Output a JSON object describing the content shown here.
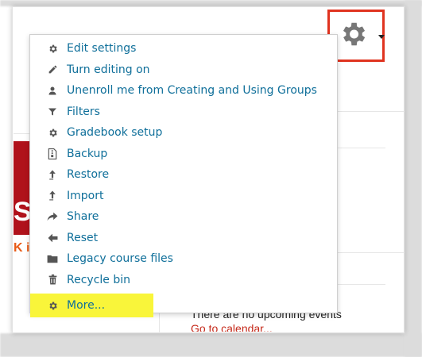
{
  "menu": {
    "items": [
      {
        "label": "Edit settings",
        "icon": "gear-icon"
      },
      {
        "label": "Turn editing on",
        "icon": "pencil-icon"
      },
      {
        "label": "Unenroll me from Creating and Using Groups",
        "icon": "user-icon"
      },
      {
        "label": "Filters",
        "icon": "filter-icon"
      },
      {
        "label": "Gradebook setup",
        "icon": "gear-icon"
      },
      {
        "label": "Backup",
        "icon": "file-archive-icon"
      },
      {
        "label": "Restore",
        "icon": "upload-icon"
      },
      {
        "label": "Import",
        "icon": "upload-icon"
      },
      {
        "label": "Share",
        "icon": "share-icon"
      },
      {
        "label": "Reset",
        "icon": "arrow-left-icon"
      },
      {
        "label": "Legacy course files",
        "icon": "folder-icon"
      },
      {
        "label": "Recycle bin",
        "icon": "trash-icon"
      },
      {
        "label": "More...",
        "icon": "gear-icon"
      }
    ]
  },
  "background": {
    "logo_fragment": "S",
    "logo_sub_fragment": "K i",
    "upcoming_text": "There are no upcoming events",
    "calendar_link": "Go to calendar..."
  },
  "colors": {
    "link": "#0f6f9a",
    "highlight": "#f9f53a",
    "callout_border": "#e0331f",
    "icon": "#555555"
  }
}
